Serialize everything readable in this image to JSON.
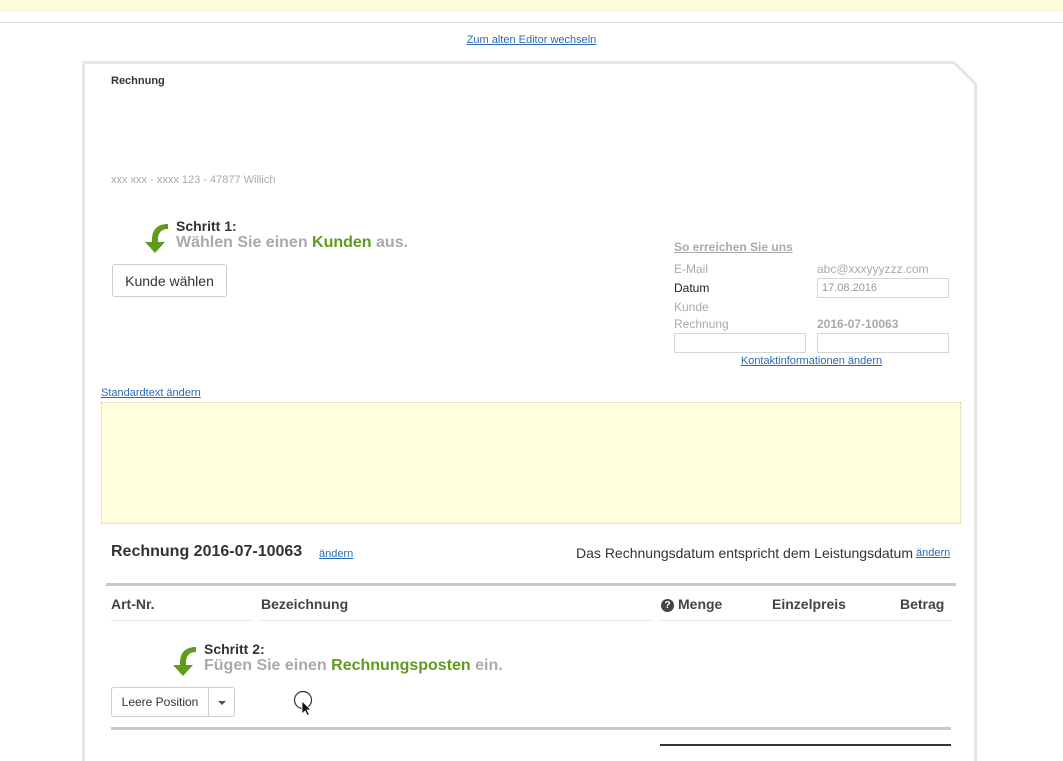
{
  "header": {
    "switch_editor_link": "Zum alten Editor wechseln"
  },
  "document": {
    "type_label": "Rechnung",
    "sender_line": "xxx xxx - xxxx 123 - 47877 Willich"
  },
  "step1": {
    "label": "Schritt 1:",
    "text_before": "Wählen Sie einen ",
    "text_highlight": "Kunden",
    "text_after": " aus.",
    "button_label": "Kunde wählen"
  },
  "contact": {
    "title": "So erreichen Sie uns",
    "email_label": "E-Mail",
    "email_value": "abc@xxxyyyzzz.com",
    "date_label": "Datum",
    "date_value": "17.08.2016",
    "customer_label": "Kunde",
    "invoice_label": "Rechnung",
    "invoice_value": "2016-07-10063",
    "customer_value": "",
    "invoice_input_value": "",
    "change_link": "Kontaktinformationen ändern"
  },
  "standard_text": {
    "change_link": "Standardtext ändern"
  },
  "invoice": {
    "title": "Rechnung 2016-07-10063",
    "title_change_link": "ändern",
    "date_note": "Das Rechnungsdatum entspricht dem Leistungsdatum",
    "date_change_link": "ändern"
  },
  "table": {
    "columns": {
      "art_nr": "Art-Nr.",
      "description": "Bezeichnung",
      "quantity": "Menge",
      "unit_price": "Einzelpreis",
      "amount": "Betrag"
    },
    "help_icon": "question-circle-icon"
  },
  "step2": {
    "label": "Schritt 2:",
    "text_before": "Fügen Sie einen ",
    "text_highlight": "Rechnungsposten",
    "text_after": " ein.",
    "button_label": "Leere Position"
  },
  "colors": {
    "accent_green": "#5f9b1c",
    "link_blue": "#2a6ab3",
    "text_box_bg": "#fffedd",
    "top_bar_bg": "#fdfbd9"
  }
}
